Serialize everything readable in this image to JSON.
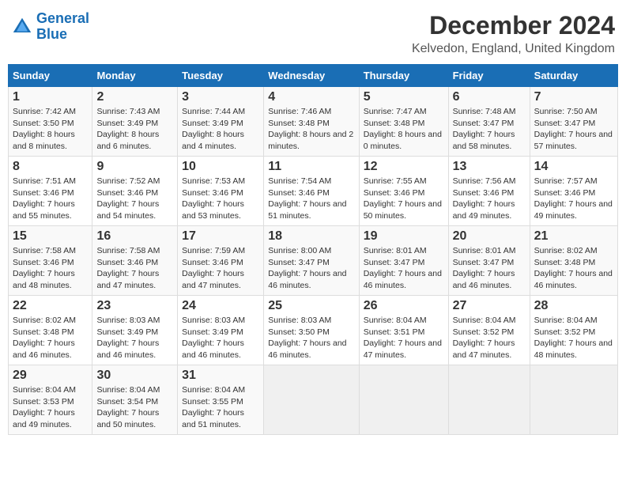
{
  "logo": {
    "line1": "General",
    "line2": "Blue"
  },
  "title": "December 2024",
  "subtitle": "Kelvedon, England, United Kingdom",
  "days_header": [
    "Sunday",
    "Monday",
    "Tuesday",
    "Wednesday",
    "Thursday",
    "Friday",
    "Saturday"
  ],
  "weeks": [
    [
      {
        "num": "1",
        "sunrise": "Sunrise: 7:42 AM",
        "sunset": "Sunset: 3:50 PM",
        "daylight": "Daylight: 8 hours and 8 minutes."
      },
      {
        "num": "2",
        "sunrise": "Sunrise: 7:43 AM",
        "sunset": "Sunset: 3:49 PM",
        "daylight": "Daylight: 8 hours and 6 minutes."
      },
      {
        "num": "3",
        "sunrise": "Sunrise: 7:44 AM",
        "sunset": "Sunset: 3:49 PM",
        "daylight": "Daylight: 8 hours and 4 minutes."
      },
      {
        "num": "4",
        "sunrise": "Sunrise: 7:46 AM",
        "sunset": "Sunset: 3:48 PM",
        "daylight": "Daylight: 8 hours and 2 minutes."
      },
      {
        "num": "5",
        "sunrise": "Sunrise: 7:47 AM",
        "sunset": "Sunset: 3:48 PM",
        "daylight": "Daylight: 8 hours and 0 minutes."
      },
      {
        "num": "6",
        "sunrise": "Sunrise: 7:48 AM",
        "sunset": "Sunset: 3:47 PM",
        "daylight": "Daylight: 7 hours and 58 minutes."
      },
      {
        "num": "7",
        "sunrise": "Sunrise: 7:50 AM",
        "sunset": "Sunset: 3:47 PM",
        "daylight": "Daylight: 7 hours and 57 minutes."
      }
    ],
    [
      {
        "num": "8",
        "sunrise": "Sunrise: 7:51 AM",
        "sunset": "Sunset: 3:46 PM",
        "daylight": "Daylight: 7 hours and 55 minutes."
      },
      {
        "num": "9",
        "sunrise": "Sunrise: 7:52 AM",
        "sunset": "Sunset: 3:46 PM",
        "daylight": "Daylight: 7 hours and 54 minutes."
      },
      {
        "num": "10",
        "sunrise": "Sunrise: 7:53 AM",
        "sunset": "Sunset: 3:46 PM",
        "daylight": "Daylight: 7 hours and 53 minutes."
      },
      {
        "num": "11",
        "sunrise": "Sunrise: 7:54 AM",
        "sunset": "Sunset: 3:46 PM",
        "daylight": "Daylight: 7 hours and 51 minutes."
      },
      {
        "num": "12",
        "sunrise": "Sunrise: 7:55 AM",
        "sunset": "Sunset: 3:46 PM",
        "daylight": "Daylight: 7 hours and 50 minutes."
      },
      {
        "num": "13",
        "sunrise": "Sunrise: 7:56 AM",
        "sunset": "Sunset: 3:46 PM",
        "daylight": "Daylight: 7 hours and 49 minutes."
      },
      {
        "num": "14",
        "sunrise": "Sunrise: 7:57 AM",
        "sunset": "Sunset: 3:46 PM",
        "daylight": "Daylight: 7 hours and 49 minutes."
      }
    ],
    [
      {
        "num": "15",
        "sunrise": "Sunrise: 7:58 AM",
        "sunset": "Sunset: 3:46 PM",
        "daylight": "Daylight: 7 hours and 48 minutes."
      },
      {
        "num": "16",
        "sunrise": "Sunrise: 7:58 AM",
        "sunset": "Sunset: 3:46 PM",
        "daylight": "Daylight: 7 hours and 47 minutes."
      },
      {
        "num": "17",
        "sunrise": "Sunrise: 7:59 AM",
        "sunset": "Sunset: 3:46 PM",
        "daylight": "Daylight: 7 hours and 47 minutes."
      },
      {
        "num": "18",
        "sunrise": "Sunrise: 8:00 AM",
        "sunset": "Sunset: 3:47 PM",
        "daylight": "Daylight: 7 hours and 46 minutes."
      },
      {
        "num": "19",
        "sunrise": "Sunrise: 8:01 AM",
        "sunset": "Sunset: 3:47 PM",
        "daylight": "Daylight: 7 hours and 46 minutes."
      },
      {
        "num": "20",
        "sunrise": "Sunrise: 8:01 AM",
        "sunset": "Sunset: 3:47 PM",
        "daylight": "Daylight: 7 hours and 46 minutes."
      },
      {
        "num": "21",
        "sunrise": "Sunrise: 8:02 AM",
        "sunset": "Sunset: 3:48 PM",
        "daylight": "Daylight: 7 hours and 46 minutes."
      }
    ],
    [
      {
        "num": "22",
        "sunrise": "Sunrise: 8:02 AM",
        "sunset": "Sunset: 3:48 PM",
        "daylight": "Daylight: 7 hours and 46 minutes."
      },
      {
        "num": "23",
        "sunrise": "Sunrise: 8:03 AM",
        "sunset": "Sunset: 3:49 PM",
        "daylight": "Daylight: 7 hours and 46 minutes."
      },
      {
        "num": "24",
        "sunrise": "Sunrise: 8:03 AM",
        "sunset": "Sunset: 3:49 PM",
        "daylight": "Daylight: 7 hours and 46 minutes."
      },
      {
        "num": "25",
        "sunrise": "Sunrise: 8:03 AM",
        "sunset": "Sunset: 3:50 PM",
        "daylight": "Daylight: 7 hours and 46 minutes."
      },
      {
        "num": "26",
        "sunrise": "Sunrise: 8:04 AM",
        "sunset": "Sunset: 3:51 PM",
        "daylight": "Daylight: 7 hours and 47 minutes."
      },
      {
        "num": "27",
        "sunrise": "Sunrise: 8:04 AM",
        "sunset": "Sunset: 3:52 PM",
        "daylight": "Daylight: 7 hours and 47 minutes."
      },
      {
        "num": "28",
        "sunrise": "Sunrise: 8:04 AM",
        "sunset": "Sunset: 3:52 PM",
        "daylight": "Daylight: 7 hours and 48 minutes."
      }
    ],
    [
      {
        "num": "29",
        "sunrise": "Sunrise: 8:04 AM",
        "sunset": "Sunset: 3:53 PM",
        "daylight": "Daylight: 7 hours and 49 minutes."
      },
      {
        "num": "30",
        "sunrise": "Sunrise: 8:04 AM",
        "sunset": "Sunset: 3:54 PM",
        "daylight": "Daylight: 7 hours and 50 minutes."
      },
      {
        "num": "31",
        "sunrise": "Sunrise: 8:04 AM",
        "sunset": "Sunset: 3:55 PM",
        "daylight": "Daylight: 7 hours and 51 minutes."
      },
      null,
      null,
      null,
      null
    ]
  ]
}
